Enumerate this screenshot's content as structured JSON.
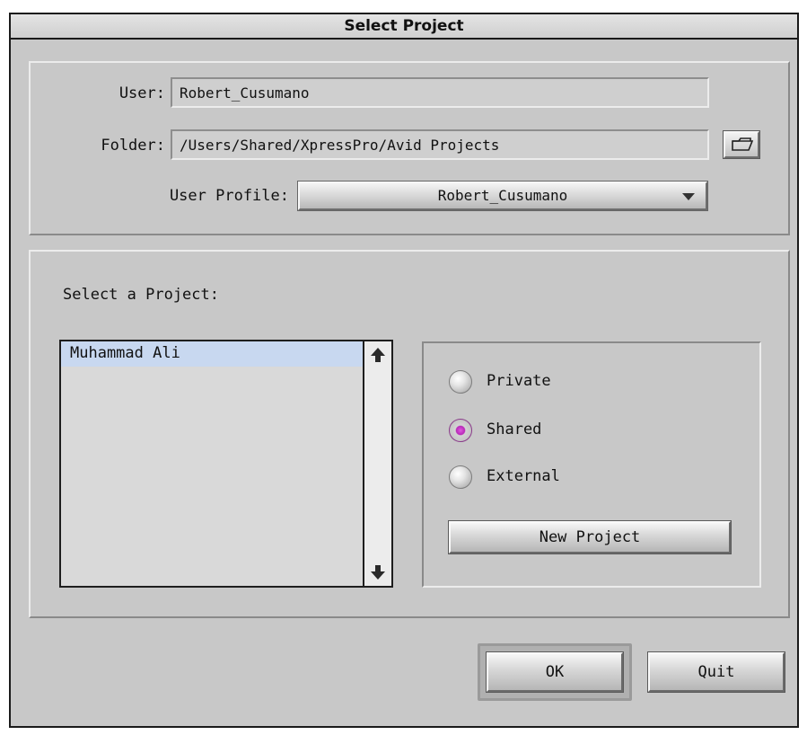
{
  "window": {
    "title": "Select Project"
  },
  "settings": {
    "user_label": "User:",
    "user_value": "Robert_Cusumano",
    "folder_label": "Folder:",
    "folder_value": "/Users/Shared/XpressPro/Avid Projects",
    "folder_button_icon": "folder-icon",
    "profile_label": "User Profile:",
    "profile_value": "Robert_Cusumano",
    "profile_arrow_icon": "chevron-down-icon"
  },
  "projects": {
    "heading": "Select a Project:",
    "items": [
      "Muhammad Ali"
    ],
    "selected_index": 0,
    "scroll_up_icon": "arrow-up-icon",
    "scroll_down_icon": "arrow-down-icon"
  },
  "location": {
    "options": [
      {
        "label": "Private",
        "checked": false
      },
      {
        "label": "Shared",
        "checked": true
      },
      {
        "label": "External",
        "checked": false
      }
    ],
    "new_project_label": "New Project"
  },
  "actions": {
    "ok_label": "OK",
    "quit_label": "Quit"
  },
  "colors": {
    "window_bg": "#c8c8c8",
    "selection": "#c8d8f0",
    "radio_selected": "#c030c0"
  }
}
